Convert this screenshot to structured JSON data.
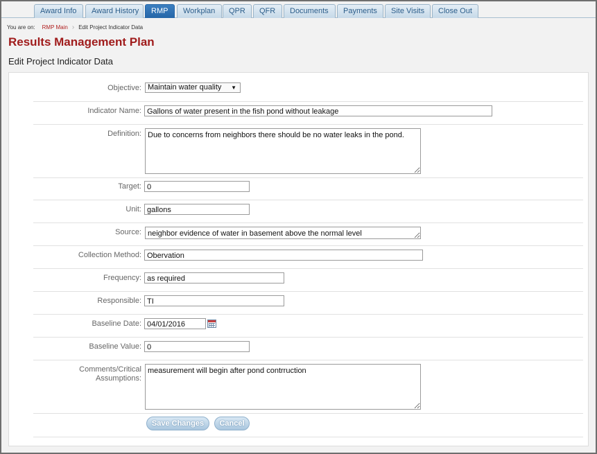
{
  "tabs": [
    {
      "label": "Award Info"
    },
    {
      "label": "Award History"
    },
    {
      "label": "RMP"
    },
    {
      "label": "Workplan"
    },
    {
      "label": "QPR"
    },
    {
      "label": "QFR"
    },
    {
      "label": "Documents"
    },
    {
      "label": "Payments"
    },
    {
      "label": "Site Visits"
    },
    {
      "label": "Close Out"
    }
  ],
  "breadcrumb": {
    "label": "You are on:",
    "link": "RMP Main",
    "current": "Edit Project Indicator Data"
  },
  "page_title": "Results Management Plan",
  "section_title": "Edit Project Indicator Data",
  "form": {
    "objective": {
      "label": "Objective:",
      "value": "Maintain water quality"
    },
    "indicator_name": {
      "label": "Indicator Name:",
      "value": "Gallons of water present in the fish pond without leakage"
    },
    "definition": {
      "label": "Definition:",
      "value": "Due to concerns from neighbors there should be no water leaks in the pond."
    },
    "target": {
      "label": "Target:",
      "value": "0"
    },
    "unit": {
      "label": "Unit:",
      "value": "gallons"
    },
    "source": {
      "label": "Source:",
      "value": "neighbor evidence of water in basement above the normal level"
    },
    "collection_method": {
      "label": "Collection Method:",
      "value": "Obervation"
    },
    "frequency": {
      "label": "Frequency:",
      "value": "as required"
    },
    "responsible": {
      "label": "Responsible:",
      "value": "TI"
    },
    "baseline_date": {
      "label": "Baseline Date:",
      "value": "04/01/2016"
    },
    "baseline_value": {
      "label": "Baseline Value:",
      "value": "0"
    },
    "comments": {
      "label_line1": "Comments/Critical",
      "label_line2": "Assumptions:",
      "value": "measurement will begin after pond contrruction"
    }
  },
  "buttons": {
    "save": "Save Changes",
    "cancel": "Cancel"
  },
  "icons": {
    "dropdown": "chevron-down-icon",
    "calendar": "calendar-icon"
  }
}
